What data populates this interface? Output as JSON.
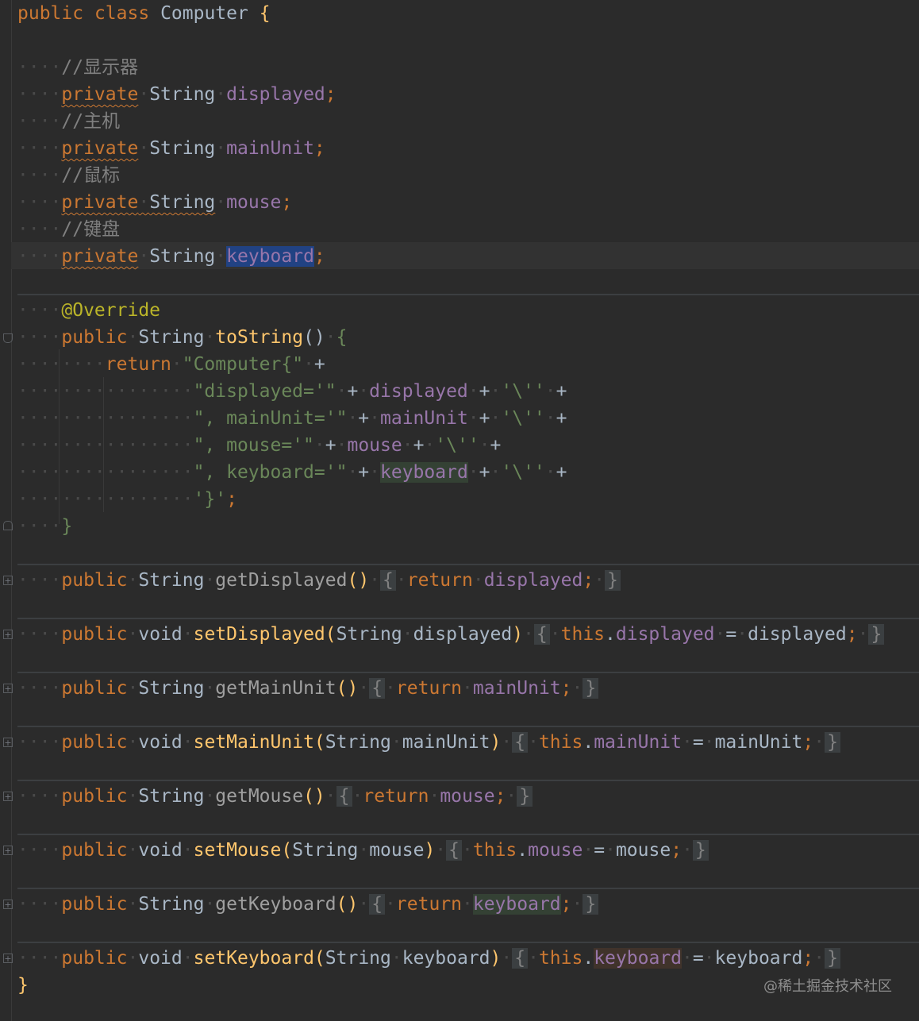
{
  "code": {
    "class_decl": {
      "keyword1": "public",
      "keyword2": "class",
      "name": "Computer",
      "open": "{"
    },
    "fields": [
      {
        "comment": "//显示器",
        "mod": "private",
        "type": "String",
        "name": "displayed"
      },
      {
        "comment": "//主机",
        "mod": "private",
        "type": "String",
        "name": "mainUnit"
      },
      {
        "comment": "//鼠标",
        "mod": "private",
        "type": "String",
        "name": "mouse"
      },
      {
        "comment": "//键盘",
        "mod": "private",
        "type": "String",
        "name": "keyboard"
      }
    ],
    "semicolon": ";",
    "tostring": {
      "annotation": "@Override",
      "sig_public": "public",
      "sig_type": "String",
      "sig_name": "toString",
      "parens": "()",
      "open": "{",
      "ret": "return",
      "s0": "\"Computer{\"",
      "s1": "\"displayed='\"",
      "s2": "\", mainUnit='\"",
      "s3": "\", mouse='\"",
      "s4": "\", keyboard='\"",
      "quote": "'\\''",
      "end": "'}'",
      "plus": "+",
      "close": "}"
    },
    "accessors": [
      {
        "mod": "public",
        "type": "String",
        "name": "getDisplayed",
        "params": "()",
        "body1": "return",
        "body2": "displayed",
        "is_setter": false
      },
      {
        "mod": "public",
        "type": "void",
        "name": "setDisplayed",
        "param_type": "String",
        "param_name": "displayed",
        "this": "this",
        "field": "displayed",
        "eq": "=",
        "value": "displayed",
        "is_setter": true
      },
      {
        "mod": "public",
        "type": "String",
        "name": "getMainUnit",
        "params": "()",
        "body1": "return",
        "body2": "mainUnit",
        "is_setter": false
      },
      {
        "mod": "public",
        "type": "void",
        "name": "setMainUnit",
        "param_type": "String",
        "param_name": "mainUnit",
        "this": "this",
        "field": "mainUnit",
        "eq": "=",
        "value": "mainUnit",
        "is_setter": true
      },
      {
        "mod": "public",
        "type": "String",
        "name": "getMouse",
        "params": "()",
        "body1": "return",
        "body2": "mouse",
        "is_setter": false
      },
      {
        "mod": "public",
        "type": "void",
        "name": "setMouse",
        "param_type": "String",
        "param_name": "mouse",
        "this": "this",
        "field": "mouse",
        "eq": "=",
        "value": "mouse",
        "is_setter": true
      },
      {
        "mod": "public",
        "type": "String",
        "name": "getKeyboard",
        "params": "()",
        "body1": "return",
        "body2": "keyboard",
        "is_setter": false
      },
      {
        "mod": "public",
        "type": "void",
        "name": "setKeyboard",
        "param_type": "String",
        "param_name": "keyboard",
        "this": "this",
        "field": "keyboard",
        "eq": "=",
        "value": "keyboard",
        "is_setter": true
      }
    ],
    "class_close": "}"
  },
  "watermark": "@稀土掘金技术社区",
  "colors": {
    "background": "#2b2b2b",
    "keyword": "#cc7832",
    "field": "#9876aa",
    "method": "#ffc66d",
    "string": "#6a8759",
    "annotation": "#bbb529",
    "comment": "#808080"
  }
}
